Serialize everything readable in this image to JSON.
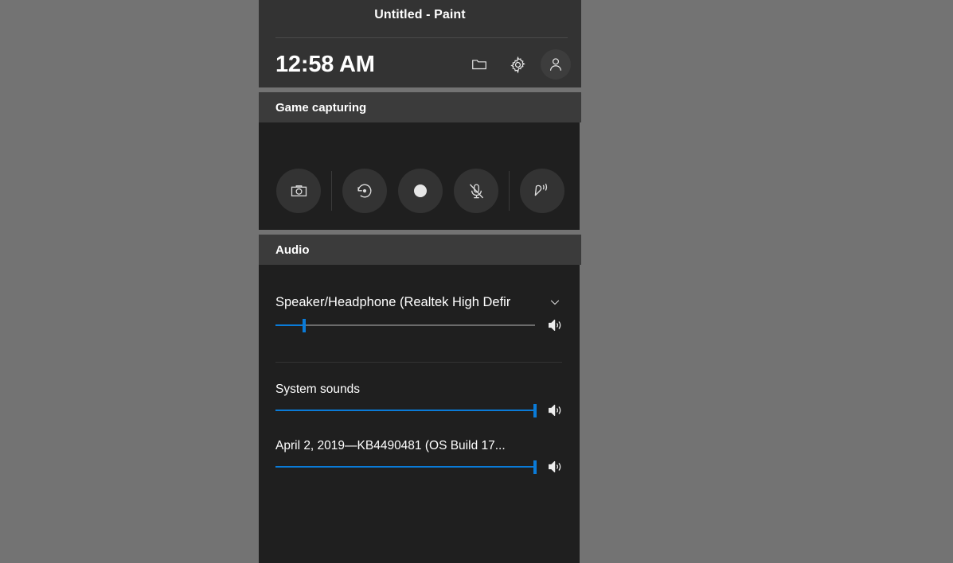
{
  "header": {
    "window_title": "Untitled - Paint",
    "clock": "12:58 AM",
    "icons": [
      {
        "name": "folder-icon",
        "label": "Open gallery"
      },
      {
        "name": "gear-icon",
        "label": "Settings"
      },
      {
        "name": "person-icon",
        "label": "Account"
      }
    ]
  },
  "game_capturing": {
    "section_title": "Game capturing",
    "buttons": [
      {
        "name": "screenshot-button",
        "icon": "camera-icon",
        "label": "Take screenshot"
      },
      {
        "name": "record-last-button",
        "icon": "record-last-icon",
        "label": "Record last 30 seconds"
      },
      {
        "name": "start-recording-button",
        "icon": "record-dot-icon",
        "label": "Start recording"
      },
      {
        "name": "microphone-toggle-button",
        "icon": "microphone-muted-icon",
        "label": "Turn mic on while recording"
      },
      {
        "name": "broadcast-button",
        "icon": "broadcast-icon",
        "label": "Broadcast"
      }
    ]
  },
  "audio": {
    "section_title": "Audio",
    "device": {
      "selected": "Speaker/Headphone (Realtek High Defir",
      "chevron": "chevron-down-icon"
    },
    "master_slider": {
      "value": 11,
      "icon": "speaker-icon"
    },
    "apps": [
      {
        "label": "System sounds",
        "value": 100,
        "icon": "speaker-icon"
      },
      {
        "label": "April 2, 2019—KB4490481 (OS Build 17...",
        "value": 100,
        "icon": "speaker-icon"
      }
    ]
  },
  "colors": {
    "accent": "#0a7bd8",
    "panel_bg": "#1f1f1f",
    "header_bg": "#3b3b3b",
    "topbar_bg": "#333333",
    "desktop_bg": "#737373",
    "text": "#ffffff"
  }
}
